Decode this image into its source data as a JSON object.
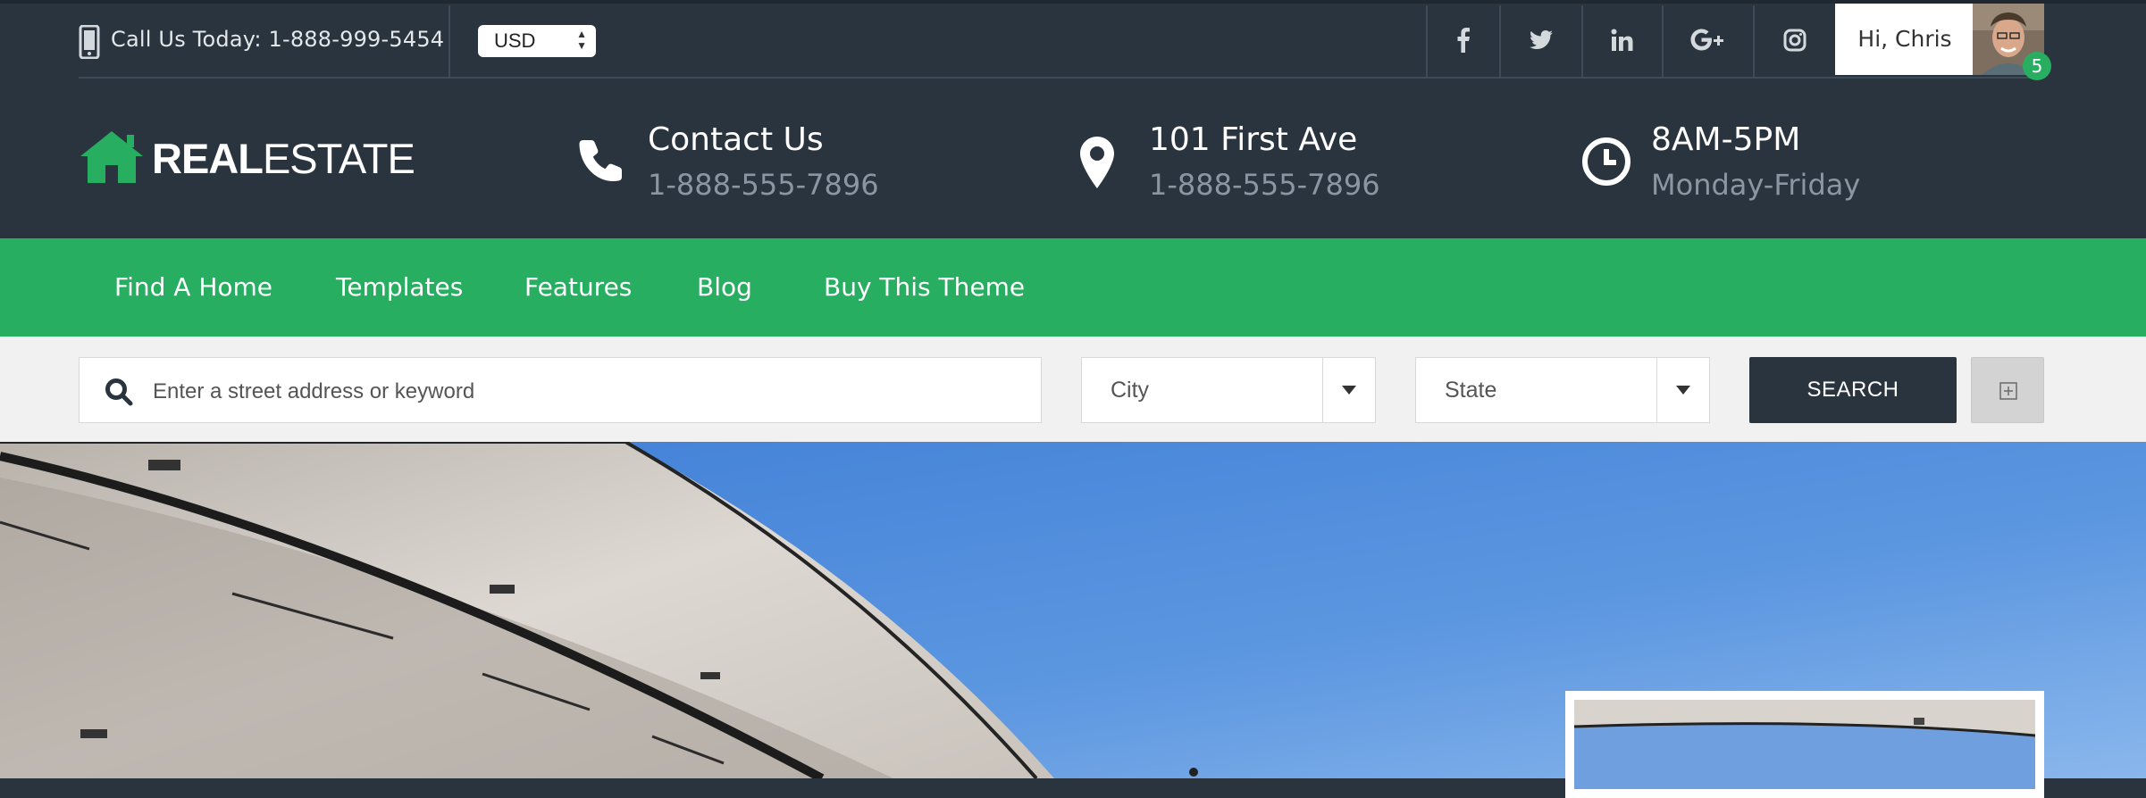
{
  "topbar": {
    "call_text": "Call Us Today: 1-888-999-5454",
    "currency": "USD",
    "social": [
      "facebook-icon",
      "twitter-icon",
      "linkedin-icon",
      "google-plus-icon",
      "instagram-icon"
    ],
    "greeting": "Hi, Chris",
    "notification_count": "5"
  },
  "header": {
    "logo_bold": "REAL",
    "logo_light": "ESTATE",
    "info": [
      {
        "icon": "phone-icon",
        "title": "Contact Us",
        "sub": "1-888-555-7896"
      },
      {
        "icon": "map-pin-icon",
        "title": "101 First Ave",
        "sub": "1-888-555-7896"
      },
      {
        "icon": "clock-icon",
        "title": "8AM-5PM",
        "sub": "Monday-Friday"
      }
    ]
  },
  "nav": {
    "items": [
      "Find A Home",
      "Templates",
      "Features",
      "Blog",
      "Buy This Theme"
    ]
  },
  "search": {
    "placeholder": "Enter a street address or keyword",
    "city": "City",
    "state": "State",
    "button": "SEARCH"
  },
  "colors": {
    "dark": "#2a343f",
    "green": "#27ae60",
    "light": "#f1f1f1"
  }
}
